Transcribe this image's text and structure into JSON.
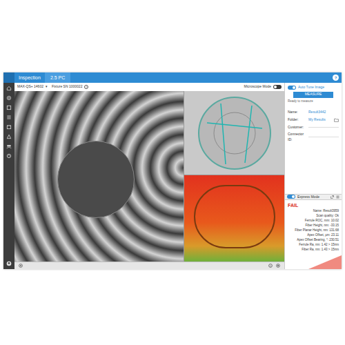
{
  "window": {
    "title": "Inspection",
    "tab": "2.5 PC",
    "help": "?"
  },
  "toolbar": {
    "device": "MAX-QS+ 14602",
    "device_arrow": "▾",
    "fixture": "Fixture SN 1000022",
    "info": "i",
    "microscope_mode": {
      "label": "Microscope Mode",
      "on": false
    }
  },
  "right_panel": {
    "auto_tune": {
      "label": "Auto Tune Image",
      "on": true
    },
    "measure_button": "MEASURE",
    "status": "Ready to measure",
    "fields": [
      {
        "label": "Name:",
        "value": "Result3442"
      },
      {
        "label": "Folder:",
        "value": "My Results"
      },
      {
        "label": "Customer:"
      },
      {
        "label": "Connector ID:"
      }
    ]
  },
  "express_mode": {
    "label": "Express Mode",
    "on": true
  },
  "result": {
    "verdict": "FAIL",
    "lines": [
      "Name: Result3959",
      "Scan quality: Ok",
      "Ferrule ROC, mm: 10.02",
      "Fiber Height, nm: -33.15",
      "Fiber Planar Height, nm: 131.68",
      "Apex Offset, µm: 23.11",
      "Apex Offset Bearing, °: 230.51",
      "Ferrule Ra, nm: 1.42 > 15nm",
      "Fiber Ra, nm: 1.43 > 15nm"
    ]
  }
}
